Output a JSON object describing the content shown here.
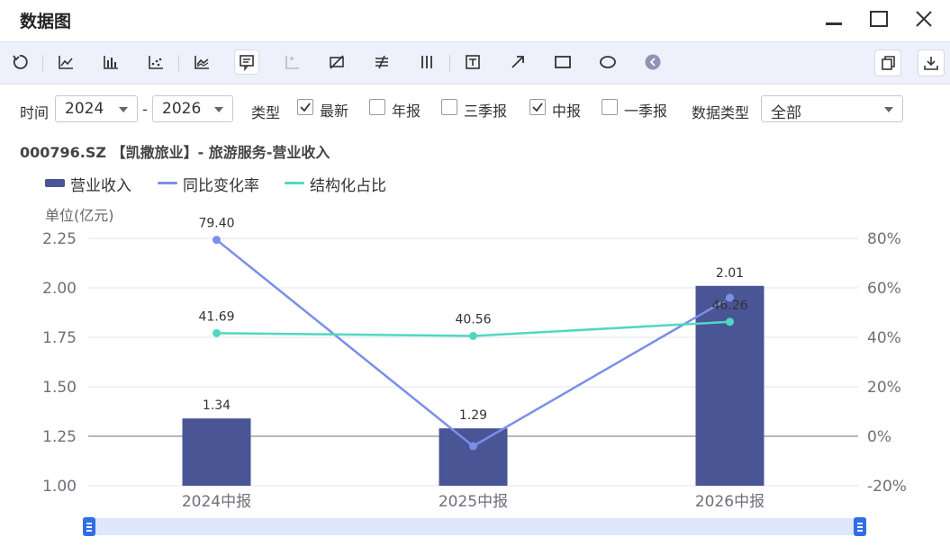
{
  "window": {
    "title": "数据图"
  },
  "filters": {
    "time_label": "时间",
    "time_from": "2024",
    "time_sep": "-",
    "time_to": "2026",
    "type_label": "类型",
    "types": [
      {
        "label": "最新",
        "checked": true
      },
      {
        "label": "年报",
        "checked": false
      },
      {
        "label": "三季报",
        "checked": false
      },
      {
        "label": "中报",
        "checked": true
      },
      {
        "label": "一季报",
        "checked": false
      }
    ],
    "data_type_label": "数据类型",
    "data_type_value": "全部"
  },
  "header": {
    "subtitle": "000796.SZ 【凯撒旅业】- 旅游服务-营业收入"
  },
  "legend": [
    {
      "label": "营业收入",
      "kind": "bar",
      "color": "#4a5596"
    },
    {
      "label": "同比变化率",
      "kind": "line",
      "color": "#7b8fe8"
    },
    {
      "label": "结构化占比",
      "kind": "line",
      "color": "#50d8c0"
    }
  ],
  "chart_data": {
    "type": "bar",
    "categories": [
      "2024中报",
      "2025中报",
      "2026中报"
    ],
    "y_unit_label": "单位(亿元)",
    "ylim": [
      1.0,
      2.25
    ],
    "yticks": [
      "2.25",
      "2.00",
      "1.75",
      "1.50",
      "1.25",
      "1.00"
    ],
    "y2lim": [
      -20,
      80
    ],
    "y2ticks": [
      "80%",
      "60%",
      "40%",
      "20%",
      "0%",
      "-20%"
    ],
    "series": [
      {
        "name": "营业收入",
        "type": "bar",
        "axis": "left",
        "values": [
          1.34,
          1.29,
          2.01
        ],
        "labels": [
          "1.34",
          "1.29",
          "2.01"
        ],
        "color": "#4a5596"
      },
      {
        "name": "同比变化率",
        "type": "line",
        "axis": "right",
        "values": [
          79.4,
          -4.0,
          56.0
        ],
        "labels": [
          "79.40",
          "",
          ""
        ],
        "color": "#7b8fe8"
      },
      {
        "name": "结构化占比",
        "type": "line",
        "axis": "right",
        "values": [
          41.69,
          40.56,
          46.26
        ],
        "labels": [
          "41.69",
          "40.56",
          "46.26"
        ],
        "color": "#50d8c0"
      }
    ],
    "grid": true,
    "legend_position": "top-left"
  }
}
